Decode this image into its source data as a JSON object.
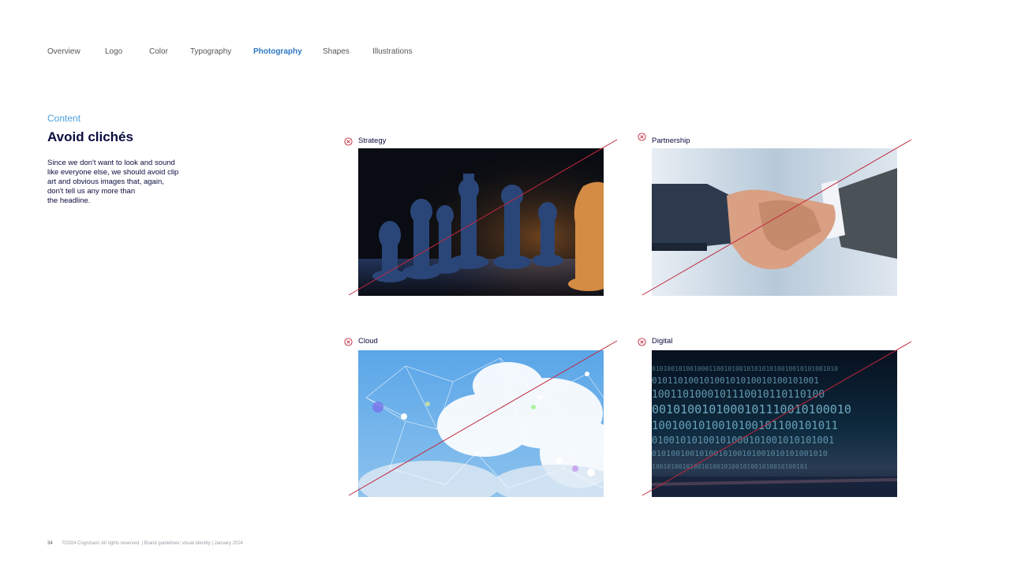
{
  "nav": {
    "items": [
      {
        "label": "Overview"
      },
      {
        "label": "Logo"
      },
      {
        "label": "Color"
      },
      {
        "label": "Typography"
      },
      {
        "label": "Photography",
        "active": true
      },
      {
        "label": "Shapes"
      },
      {
        "label": "Illustrations"
      }
    ]
  },
  "section": {
    "label": "Content",
    "title": "Avoid clichés",
    "body_lines": [
      "Since we don't want to look and sound",
      "like everyone else, we should avoid clip",
      "art and obvious images that, again,",
      "don't tell us any more than",
      "the headline."
    ]
  },
  "examples": [
    {
      "caption": "Strategy",
      "icon": "x-circle-icon",
      "photo": "chess-pieces"
    },
    {
      "caption": "Partnership",
      "icon": "x-circle-icon",
      "photo": "business-handshake"
    },
    {
      "caption": "Cloud",
      "icon": "x-circle-icon",
      "photo": "network-over-cloud"
    },
    {
      "caption": "Digital",
      "icon": "x-circle-icon",
      "photo": "binary-code"
    }
  ],
  "footer": {
    "page_number": "34",
    "text": "©2024 Cognizant. All rights reserved.  |  Brand guidelines: visual identity  |  January 2024"
  },
  "colors": {
    "navy": "#0b0c3f",
    "active_nav": "#2f78c4",
    "accent_blue": "#4ba3e0",
    "strike_red": "#c0273d"
  }
}
